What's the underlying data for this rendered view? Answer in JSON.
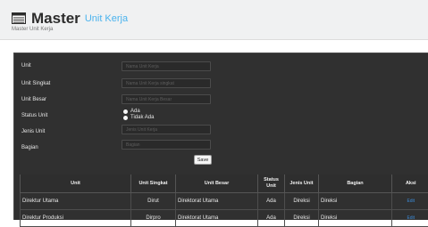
{
  "header": {
    "title": "Master",
    "subtitle": "Unit Kerja",
    "breadcrumb": "Master Unit Kerja"
  },
  "form": {
    "unit": {
      "label": "Unit",
      "placeholder": "Nama Unit Kerja"
    },
    "unit_singkat": {
      "label": "Unit Singkat",
      "placeholder": "Nama Unit Kerja singkat"
    },
    "unit_besar": {
      "label": "Unit Besar",
      "placeholder": "Nama Unit Kerja Besar"
    },
    "status_unit": {
      "label": "Status Unit",
      "options": [
        "Ada",
        "Tidak Ada"
      ]
    },
    "jenis_unit": {
      "label": "Jenis Unit",
      "placeholder": "Jenis Unit Kerja"
    },
    "bagian": {
      "label": "Bagian",
      "placeholder": "Bagian"
    },
    "save_label": "Save"
  },
  "table": {
    "headers": [
      "Unit",
      "Unit Singkat",
      "Unit Besar",
      "Status\nUnit",
      "Jenis Unit",
      "Bagian",
      "Aksi"
    ],
    "rows": [
      {
        "unit": "Direktur Utama",
        "singkat": "Dirut",
        "besar": "Direktorat Utama",
        "status": "Ada",
        "jenis": "Direksi",
        "bagian": "Direksi",
        "aksi": "Edit"
      },
      {
        "unit": "Direktur Produksi",
        "singkat": "Dirpro",
        "besar": "Direktorat Utama",
        "status": "Ada",
        "jenis": "Direksi",
        "bagian": "Direksi",
        "aksi": "Edit"
      }
    ]
  },
  "colors": {
    "accent": "#4ab3ee",
    "panel": "#303030",
    "link": "#3b8ad6"
  },
  "icons": {
    "title": "table-icon"
  }
}
